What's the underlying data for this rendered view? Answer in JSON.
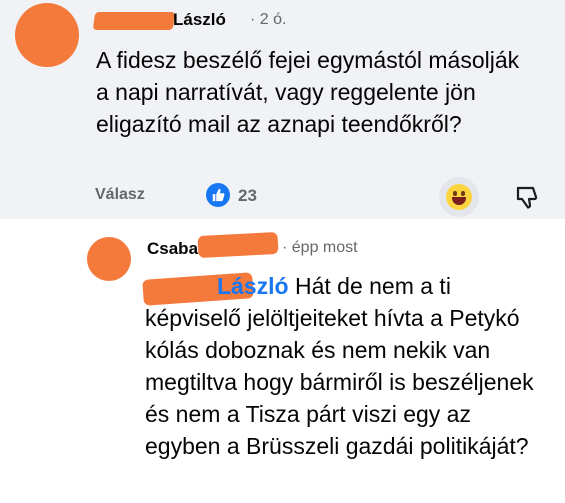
{
  "comment1": {
    "author_suffix": "László",
    "time": "· 2 ó.",
    "text": "A fidesz beszélő fejei egymástól másolják a napi narratívát, vagy reggelente jön eligazító mail az aznapi teendőkről?",
    "reply_label": "Válasz",
    "like_count": "23"
  },
  "comment2": {
    "author_prefix": "Csaba",
    "time": "· épp most",
    "mention_suffix": "László",
    "text": " Hát de nem a ti képviselő jelöltjeiteket hívta a Petykó kólás doboznak és nem nekik van megtiltva hogy bármiről is beszéljenek és nem a Tisza párt viszi egy az egyben a Brüsszeli gazdái politikáját?"
  },
  "icons": {
    "like": "thumbs-up-icon",
    "reaction": "laughing-emoji-icon",
    "dislike": "thumbs-down-icon"
  },
  "colors": {
    "accent": "#1877f2",
    "redaction": "#f47a3c",
    "muted": "#65676b"
  }
}
